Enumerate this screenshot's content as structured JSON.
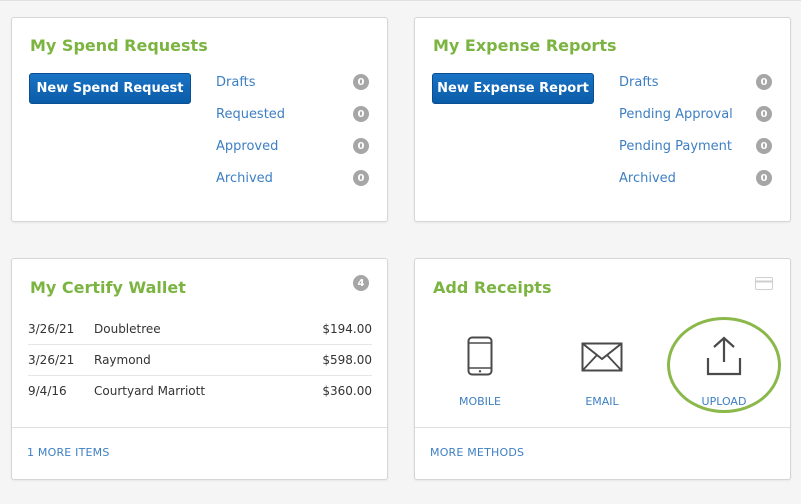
{
  "spend": {
    "title": "My Spend Requests",
    "button_label": "New Spend Request",
    "statuses": [
      {
        "label": "Drafts",
        "count": "0"
      },
      {
        "label": "Requested",
        "count": "0"
      },
      {
        "label": "Approved",
        "count": "0"
      },
      {
        "label": "Archived",
        "count": "0"
      }
    ]
  },
  "expense": {
    "title": "My Expense Reports",
    "button_label": "New Expense Report",
    "statuses": [
      {
        "label": "Drafts",
        "count": "0"
      },
      {
        "label": "Pending Approval",
        "count": "0"
      },
      {
        "label": "Pending Payment",
        "count": "0"
      },
      {
        "label": "Archived",
        "count": "0"
      }
    ]
  },
  "wallet": {
    "title": "My Certify Wallet",
    "count": "4",
    "items": [
      {
        "date": "3/26/21",
        "merchant": "Doubletree",
        "amount": "$194.00"
      },
      {
        "date": "3/26/21",
        "merchant": "Raymond",
        "amount": "$598.00"
      },
      {
        "date": "9/4/16",
        "merchant": "Courtyard Marriott",
        "amount": "$360.00"
      }
    ],
    "more_link": "1 MORE ITEMS"
  },
  "receipts": {
    "title": "Add Receipts",
    "methods": [
      {
        "label": "MOBILE",
        "icon": "mobile-phone-icon"
      },
      {
        "label": "EMAIL",
        "icon": "envelope-icon"
      },
      {
        "label": "UPLOAD",
        "icon": "upload-icon"
      }
    ],
    "more_link": "MORE METHODS",
    "highlight_color": "#8ab84a"
  },
  "colors": {
    "title_green": "#7cb442",
    "link_blue": "#3d7fc3",
    "button_blue": "#0a5ca8",
    "badge_gray": "#a6a6a6"
  }
}
